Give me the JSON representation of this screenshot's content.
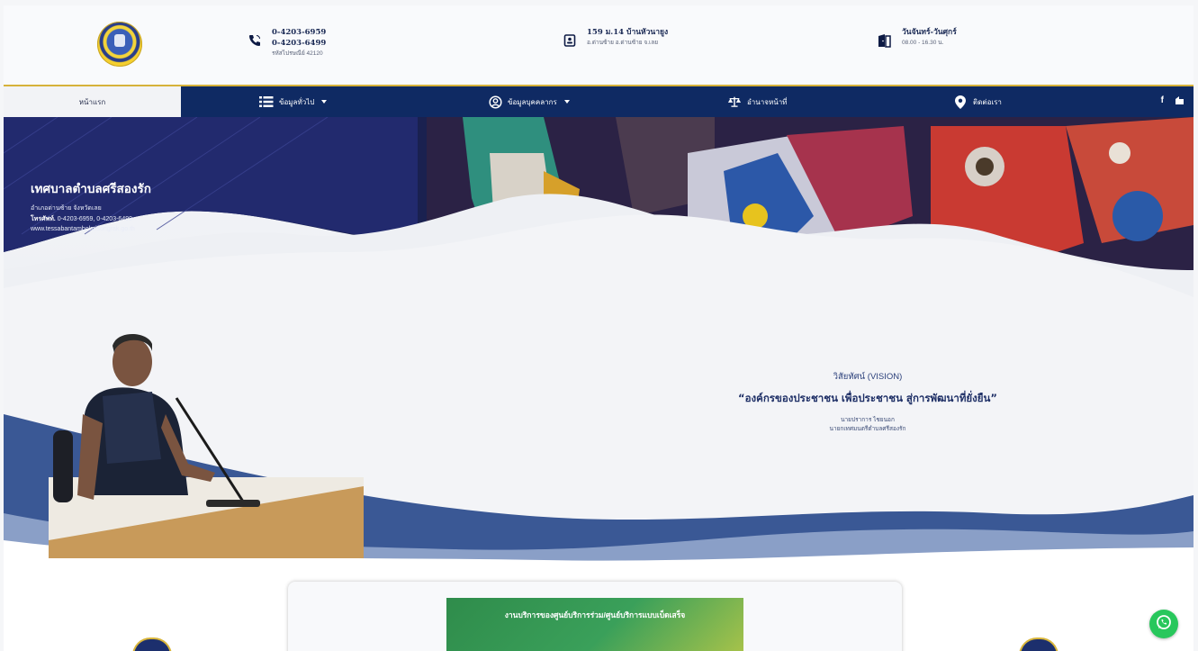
{
  "header": {
    "phone": {
      "line1": "0-4203-6959",
      "line2": "0-4203-6499",
      "line3": "รหัสไปรษณีย์ 42120"
    },
    "address": {
      "line1": "159 ม.14 บ้านหัวนายูง",
      "line2": "อ.ด่านซ้าย อ.ด่านซ้าย จ.เลย"
    },
    "hours": {
      "line1": "วันจันทร์-วันศุกร์",
      "line2": "08.00 - 16.30 น."
    }
  },
  "nav": {
    "home": "หน้าแรก",
    "general": "ข้อมูลทั่วไป",
    "personnel": "ข้อมูลบุคคลากร",
    "authority": "อำนาจหน้าที่",
    "contact": "ติดต่อเรา"
  },
  "social": {
    "facebook": "f"
  },
  "hero": {
    "org_name": "เทศบาลตำบลศรีสองรัก",
    "district": "อำเภอด่านซ้าย จังหวัดเลย",
    "phone_label": "โทรศัพท์.",
    "phone_value": " 0-4203-6959, 0-4203-6499",
    "website": "www.tessabantambolsrisongrak.go.th"
  },
  "vision": {
    "label": "วิสัยทัศน์ (VISION)",
    "quote": "“องค์กรของประชาชน เพื่อประชาชน สู่การพัฒนาที่ยั่งยืน”",
    "person_name": "นายปราการ ไชยนอก",
    "person_title": "นายกเทศมนตรีตำบลศรีสองรัก"
  },
  "service_banner": {
    "title": "งานบริการของศูนย์บริการร่วม/ศูนย์บริการแบบเบ็ดเสร็จ"
  },
  "colors": {
    "nav": "#0f2a63",
    "accent": "#d6b23a",
    "whatsapp": "#28c75c"
  }
}
